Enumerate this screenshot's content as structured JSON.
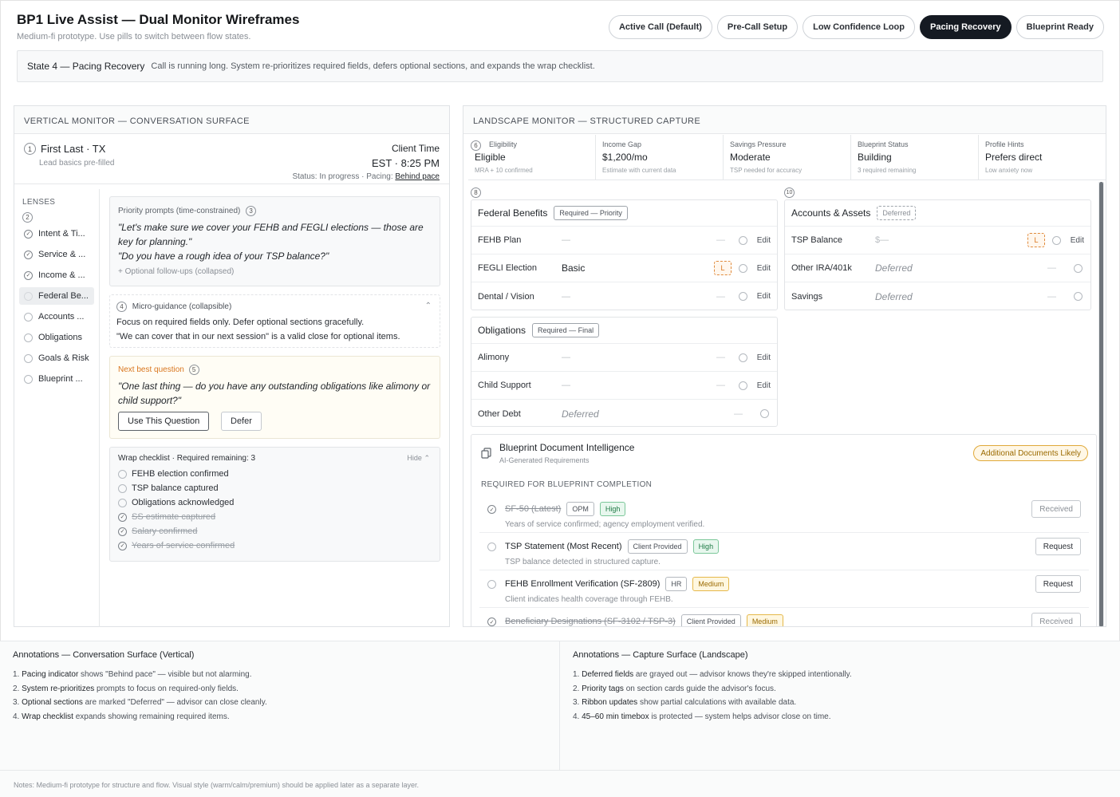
{
  "header": {
    "title": "BP1 Live Assist — Dual Monitor Wireframes",
    "subtitle": "Medium-fi prototype. Use pills to switch between flow states.",
    "pills": [
      "Active Call (Default)",
      "Pre-Call Setup",
      "Low Confidence Loop",
      "Pacing Recovery",
      "Blueprint Ready"
    ],
    "active_pill": "Pacing Recovery"
  },
  "state": {
    "title": "State 4 — Pacing Recovery",
    "description": "Call is running long. System re-prioritizes required fields, defers optional sections, and expands the wrap checklist."
  },
  "vertical": {
    "panel_title": "VERTICAL MONITOR — CONVERSATION SURFACE",
    "client_num": "1",
    "client_name": "First Last · TX",
    "client_note": "Lead basics pre-filled",
    "client_time_label": "Client Time",
    "client_time": "EST · 8:25 PM",
    "status_prefix": "Status: In progress · Pacing:",
    "status_link": "Behind pace",
    "lenses_label": "LENSES",
    "lenses_num": "2",
    "lenses": [
      {
        "label": "Intent & Ti...",
        "state": "checked"
      },
      {
        "label": "Service & ...",
        "state": "checked"
      },
      {
        "label": "Income & ...",
        "state": "checked"
      },
      {
        "label": "Federal Be...",
        "state": "active"
      },
      {
        "label": "Accounts ...",
        "state": "open"
      },
      {
        "label": "Obligations",
        "state": "open"
      },
      {
        "label": "Goals & Risk",
        "state": "open"
      },
      {
        "label": "Blueprint ...",
        "state": "open"
      }
    ],
    "priority": {
      "label": "Priority prompts (time-constrained)",
      "num": "3",
      "quote1": "\"Let's make sure we cover your FEHB and FEGLI elections — those are key for planning.\"",
      "quote2": "\"Do you have a rough idea of your TSP balance?\"",
      "followups": "+ Optional follow-ups (collapsed)"
    },
    "micro": {
      "num": "4",
      "label": "Micro-guidance (collapsible)",
      "line1": "Focus on required fields only. Defer optional sections gracefully.",
      "line2": "\"We can cover that in our next session\" is a valid close for optional items."
    },
    "nbq": {
      "label": "Next best question",
      "num": "5",
      "quote": "\"One last thing — do you have any outstanding obligations like alimony or child support?\"",
      "use_btn": "Use This Question",
      "defer_btn": "Defer"
    },
    "wrap": {
      "title": "Wrap checklist · Required remaining: 3",
      "hide": "Hide",
      "items": [
        {
          "label": "FEHB election confirmed",
          "done": false
        },
        {
          "label": "TSP balance captured",
          "done": false
        },
        {
          "label": "Obligations acknowledged",
          "done": false
        },
        {
          "label": "SS estimate captured",
          "done": true
        },
        {
          "label": "Salary confirmed",
          "done": true
        },
        {
          "label": "Years of service confirmed",
          "done": true
        }
      ]
    }
  },
  "landscape": {
    "panel_title": "LANDSCAPE MONITOR — STRUCTURED CAPTURE",
    "ribbon_num": "6",
    "ribbon": [
      {
        "label": "Eligibility",
        "value": "Eligible",
        "sub": "MRA + 10 confirmed"
      },
      {
        "label": "Income Gap",
        "value": "$1,200/mo",
        "sub": "Estimate with current data"
      },
      {
        "label": "Savings Pressure",
        "value": "Moderate",
        "sub": "TSP needed for accuracy"
      },
      {
        "label": "Blueprint Status",
        "value": "Building",
        "sub": "3 required remaining"
      },
      {
        "label": "Profile Hints",
        "value": "Prefers direct",
        "sub": "Low anxiety now"
      }
    ],
    "federal": {
      "num": "8",
      "title": "Federal Benefits",
      "tag": "Required — Priority",
      "rows": [
        {
          "label": "FEHB Plan",
          "value": "—",
          "kind": "empty",
          "conf": "—",
          "edit": "Edit"
        },
        {
          "label": "FEGLI Election",
          "value": "Basic",
          "kind": "val",
          "conf": "L",
          "edit": "Edit"
        },
        {
          "label": "Dental / Vision",
          "value": "—",
          "kind": "empty",
          "conf": "—",
          "edit": "Edit"
        }
      ]
    },
    "obligations": {
      "title": "Obligations",
      "tag": "Required — Final",
      "rows": [
        {
          "label": "Alimony",
          "value": "—",
          "kind": "empty",
          "conf": "—",
          "edit": "Edit"
        },
        {
          "label": "Child Support",
          "value": "—",
          "kind": "empty",
          "conf": "—",
          "edit": "Edit"
        },
        {
          "label": "Other Debt",
          "value": "Deferred",
          "kind": "def",
          "conf": "—",
          "edit": ""
        }
      ]
    },
    "accounts": {
      "num": "10",
      "title": "Accounts & Assets",
      "tag": "Deferred",
      "rows": [
        {
          "label": "TSP Balance",
          "value": "$—",
          "kind": "empty",
          "conf": "L",
          "edit": "Edit"
        },
        {
          "label": "Other IRA/401k",
          "value": "Deferred",
          "kind": "def",
          "conf": "—",
          "edit": ""
        },
        {
          "label": "Savings",
          "value": "Deferred",
          "kind": "def",
          "conf": "—",
          "edit": ""
        }
      ]
    },
    "docs": {
      "title": "Blueprint Document Intelligence",
      "subtitle": "AI-Generated Requirements",
      "badge": "Additional Documents Likely",
      "section": "REQUIRED FOR BLUEPRINT COMPLETION",
      "items": [
        {
          "name": "SF-50 (Latest)",
          "source": "OPM",
          "priority": "High",
          "desc": "Years of service confirmed; agency employment verified.",
          "status": "Received",
          "done": true
        },
        {
          "name": "TSP Statement (Most Recent)",
          "source": "Client Provided",
          "priority": "High",
          "desc": "TSP balance detected in structured capture.",
          "status": "Request",
          "done": false
        },
        {
          "name": "FEHB Enrollment Verification (SF-2809)",
          "source": "HR",
          "priority": "Medium",
          "desc": "Client indicates health coverage through FEHB.",
          "status": "Request",
          "done": false
        },
        {
          "name": "Beneficiary Designations (SF-3102 / TSP-3)",
          "source": "Client Provided",
          "priority": "Medium",
          "desc": "",
          "status": "Received",
          "done": true
        }
      ]
    }
  },
  "annotations": {
    "left": {
      "title": "Annotations — Conversation Surface (Vertical)",
      "items": [
        {
          "n": "1.",
          "k": "Pacing indicator",
          "t": " shows \"Behind pace\" — visible but not alarming."
        },
        {
          "n": "2.",
          "k": "System re-prioritizes",
          "t": " prompts to focus on required-only fields."
        },
        {
          "n": "3.",
          "k": "Optional sections",
          "t": " are marked \"Deferred\" — advisor can close cleanly."
        },
        {
          "n": "4.",
          "k": "Wrap checklist",
          "t": " expands showing remaining required items."
        }
      ]
    },
    "right": {
      "title": "Annotations — Capture Surface (Landscape)",
      "items": [
        {
          "n": "1.",
          "k": "Deferred fields",
          "t": " are grayed out — advisor knows they're skipped intentionally."
        },
        {
          "n": "2.",
          "k": "Priority tags",
          "t": " on section cards guide the advisor's focus."
        },
        {
          "n": "3.",
          "k": "Ribbon updates",
          "t": " show partial calculations with available data."
        },
        {
          "n": "4.",
          "k": "45–60 min timebox",
          "t": " is protected — system helps advisor close on time."
        }
      ]
    }
  },
  "footer": "Notes: Medium-fi prototype for structure and flow. Visual style (warm/calm/premium) should be applied later as a separate layer."
}
